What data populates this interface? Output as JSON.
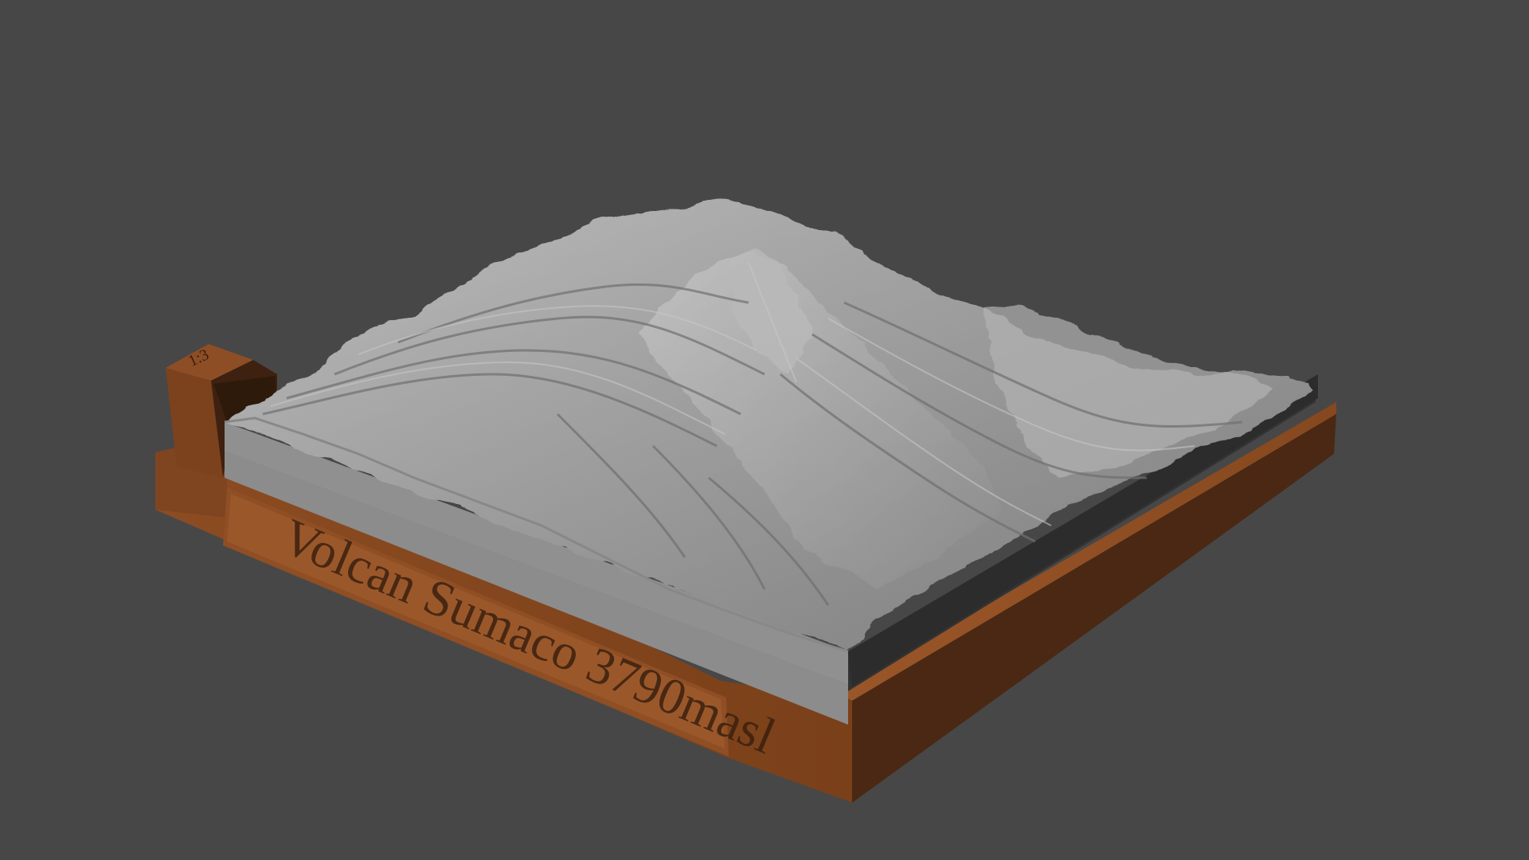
{
  "scene": {
    "background_color": "#474747",
    "subject": "3D terrain relief model on a base",
    "terrain_color": "#9a9a9a",
    "base_color": "#8a4a22",
    "plaque_text": "Volcan Sumaco 3790masl",
    "small_tag_text": "1:3"
  }
}
